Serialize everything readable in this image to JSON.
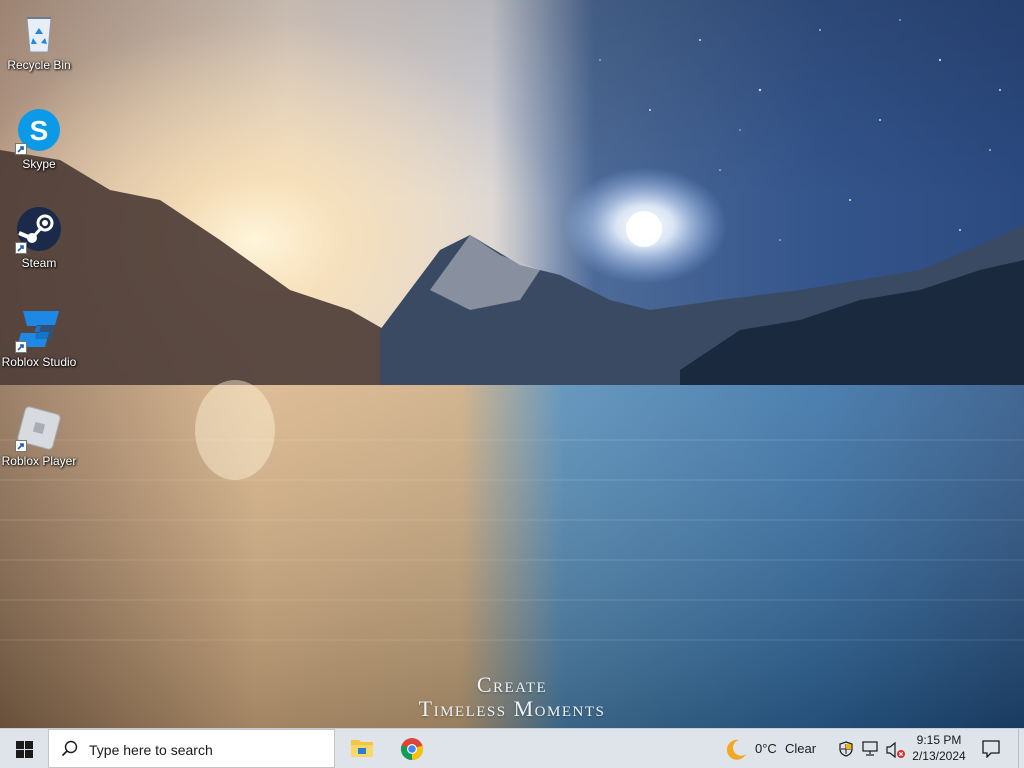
{
  "wallpaper": {
    "line1": "Create",
    "line2": "Timeless Moments"
  },
  "desktop_icons": [
    {
      "label": "Recycle Bin",
      "icon": "recycle-bin-icon"
    },
    {
      "label": "Skype",
      "icon": "skype-icon"
    },
    {
      "label": "Steam",
      "icon": "steam-icon"
    },
    {
      "label": "Roblox Studio",
      "icon": "roblox-studio-icon"
    },
    {
      "label": "Roblox Player",
      "icon": "roblox-player-icon"
    }
  ],
  "taskbar": {
    "search_placeholder": "Type here to search",
    "pinned": [
      {
        "name": "File Explorer",
        "icon": "file-explorer-icon"
      },
      {
        "name": "Google Chrome",
        "icon": "chrome-icon"
      }
    ],
    "weather": {
      "temp": "0°C",
      "condition": "Clear",
      "icon": "moon-icon"
    },
    "tray": [
      "security-shield-icon",
      "network-icon",
      "volume-muted-icon"
    ],
    "time": "9:15 PM",
    "date": "2/13/2024"
  },
  "colors": {
    "taskbar_bg": "#dfe3ea",
    "skype_blue": "#0c9ae8",
    "steam_navy": "#1b2a4a",
    "roblox_studio_blue": "#1e88e5"
  }
}
